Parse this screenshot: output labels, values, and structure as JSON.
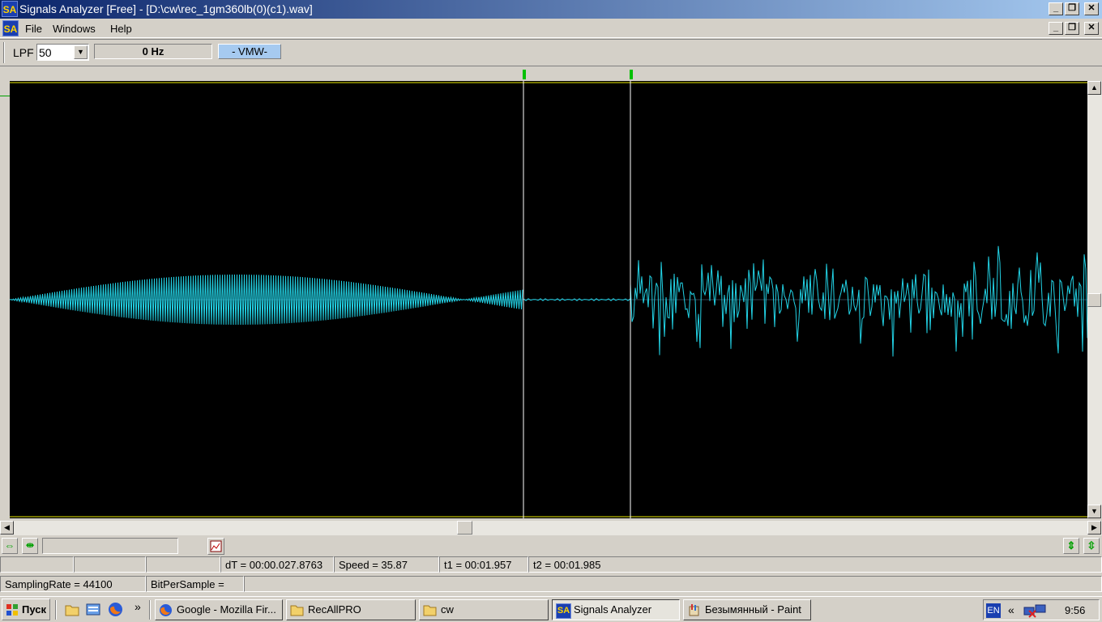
{
  "window": {
    "title": "Signals Analyzer [Free] - [D:\\cw\\rec_1gm360lb(0)(c1).wav]",
    "logo_text": "SA",
    "minimize": "_",
    "restore": "❐",
    "close": "✕"
  },
  "menu": {
    "items": [
      "File",
      "Windows",
      "Help"
    ]
  },
  "toolbar": {
    "lpf_label": "LPF",
    "lpf_value": "50",
    "freq_readout": "0 Hz",
    "mode_button": "- VMW-"
  },
  "waveform": {
    "cursor1_fraction": 0.477,
    "cursor2_fraction": 0.576,
    "colors": {
      "signal": "#22d3e6",
      "cursor": "#ffffff",
      "limit": "#e8e800",
      "marker": "#00c000",
      "background": "#000000"
    }
  },
  "status": {
    "dt": "dT = 00:00.027.8763",
    "speed": "Speed = 35.87",
    "t1": "t1 = 00:01.957",
    "t2": "t2 = 00:01.985",
    "sampling_rate": "SamplingRate = 44100",
    "bits_per_sample": "BitPerSample ="
  },
  "taskbar": {
    "start_label": "Пуск",
    "quicklaunch_more": "»",
    "tasks": [
      {
        "label": "Google - Mozilla Fir...",
        "icon": "firefox-icon"
      },
      {
        "label": "RecAllPRO",
        "icon": "folder-icon"
      },
      {
        "label": "cw",
        "icon": "folder-icon"
      },
      {
        "label": "Signals Analyzer",
        "icon": "sa-icon",
        "active": true
      },
      {
        "label": "Безымянный - Paint",
        "icon": "paint-icon"
      }
    ],
    "tray": {
      "language": "EN",
      "expand": "«",
      "clock": "9:56"
    }
  }
}
